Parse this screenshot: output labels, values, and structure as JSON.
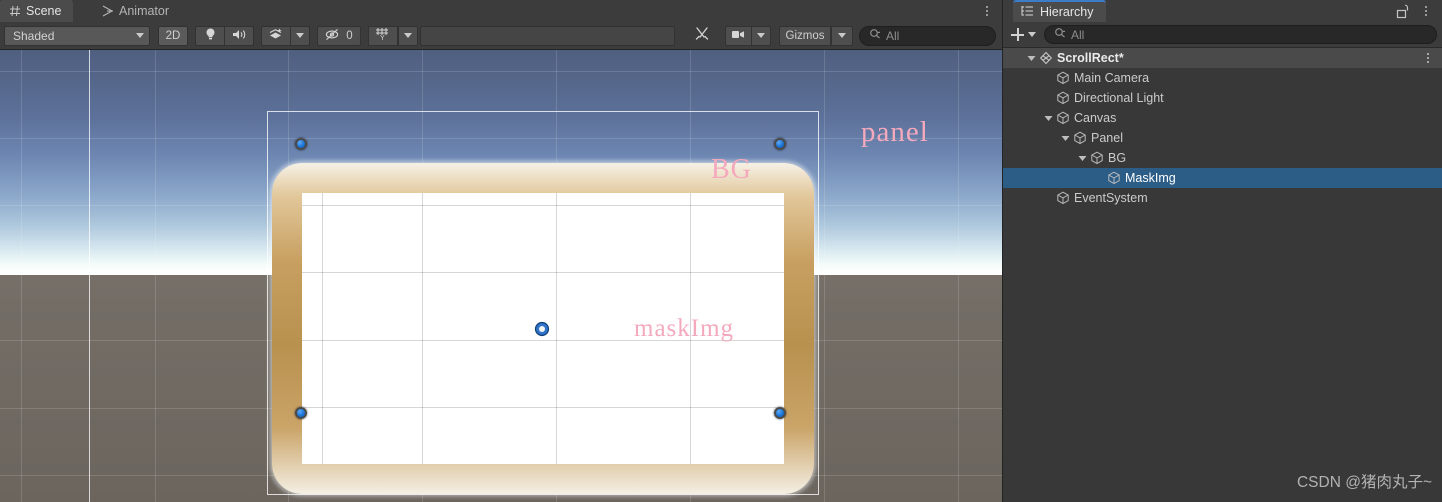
{
  "scene": {
    "tabs": [
      {
        "label": "Scene",
        "icon": "grid-hash-icon",
        "active": true
      },
      {
        "label": "Animator",
        "icon": "animator-icon",
        "active": false
      }
    ],
    "toolbar": {
      "shading_mode": "Shaded",
      "mode_2d": "2D",
      "lighting_icon": "lightbulb-icon",
      "audio_icon": "speaker-icon",
      "fx_icon": "effects-layers-icon",
      "fx_caret": "chevron-down-icon",
      "hidden_count": "0",
      "hidden_icon": "eye-slash-icon",
      "grid_icon": "grid-axis-y-icon",
      "grid_caret": "chevron-down-icon",
      "tools_icon": "tools-wrench-icon",
      "camera_icon": "scene-camera-icon",
      "camera_caret": "chevron-down-icon",
      "gizmos_label": "Gizmos",
      "gizmos_caret": "chevron-down-icon",
      "search_placeholder": "All",
      "search_value": "",
      "search_icon": "search-icon"
    },
    "labels": {
      "panel": "panel",
      "bg": "BG",
      "mask": "maskImg"
    },
    "colors": {
      "label_pink": "#f4a9bd",
      "frame_gold": "#c79f60",
      "anchor_blue": "#1b76d8",
      "sky_top": "#4f5f80",
      "ground": "#6f6962"
    }
  },
  "hierarchy": {
    "tab": {
      "label": "Hierarchy",
      "icon": "hierarchy-list-icon"
    },
    "lock_icon": "padlock-open-icon",
    "kebab_icon": "kebab-menu-icon",
    "toolbar": {
      "add_label": "+",
      "add_icon": "plus-icon",
      "add_caret": "chevron-down-icon",
      "search_icon": "search-icon",
      "search_placeholder": "All",
      "search_value": ""
    },
    "rows": [
      {
        "label": "ScrollRect*",
        "depth": 0,
        "arrow": "open",
        "icon": "scene-asset-icon",
        "root": true,
        "selected": false,
        "kebab": true
      },
      {
        "label": "Main Camera",
        "depth": 1,
        "arrow": "none",
        "icon": "gameobject-cube-icon",
        "root": false,
        "selected": false,
        "kebab": false
      },
      {
        "label": "Directional Light",
        "depth": 1,
        "arrow": "none",
        "icon": "gameobject-cube-icon",
        "root": false,
        "selected": false,
        "kebab": false
      },
      {
        "label": "Canvas",
        "depth": 1,
        "arrow": "open",
        "icon": "gameobject-cube-icon",
        "root": false,
        "selected": false,
        "kebab": false
      },
      {
        "label": "Panel",
        "depth": 2,
        "arrow": "open",
        "icon": "gameobject-cube-icon",
        "root": false,
        "selected": false,
        "kebab": false
      },
      {
        "label": "BG",
        "depth": 3,
        "arrow": "open",
        "icon": "gameobject-cube-icon",
        "root": false,
        "selected": false,
        "kebab": false
      },
      {
        "label": "MaskImg",
        "depth": 4,
        "arrow": "none",
        "icon": "gameobject-cube-icon",
        "root": false,
        "selected": true,
        "kebab": false
      },
      {
        "label": "EventSystem",
        "depth": 1,
        "arrow": "none",
        "icon": "gameobject-cube-icon",
        "root": false,
        "selected": false,
        "kebab": false
      }
    ]
  },
  "watermark": {
    "text": "CSDN @猪肉丸子~"
  }
}
